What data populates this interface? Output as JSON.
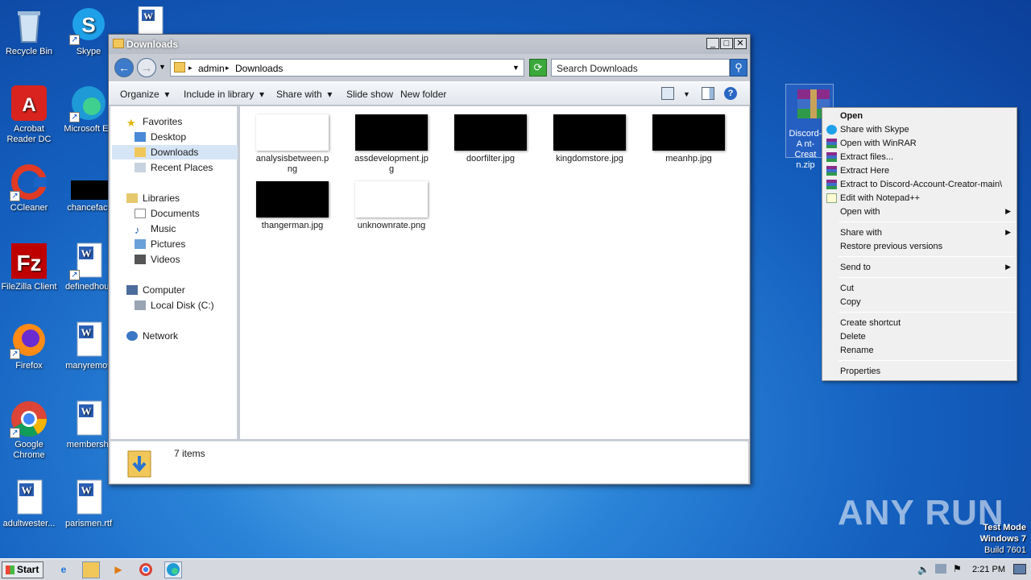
{
  "desktop": {
    "icons": [
      {
        "label": "Recycle Bin",
        "icon": "recycle-bin-icon"
      },
      {
        "label": "Skype",
        "icon": "skype-icon"
      },
      {
        "label": "",
        "icon": "word-doc-icon"
      },
      {
        "label": "Acrobat Reader DC",
        "icon": "acrobat-icon"
      },
      {
        "label": "Microsoft Ed",
        "icon": "edge-icon"
      },
      {
        "label": "CCleaner",
        "icon": "ccleaner-icon"
      },
      {
        "label": "chancefact",
        "icon": "black-file-icon"
      },
      {
        "label": "FileZilla Client",
        "icon": "filezilla-icon"
      },
      {
        "label": "definedhour",
        "icon": "word-doc-icon"
      },
      {
        "label": "Firefox",
        "icon": "firefox-icon"
      },
      {
        "label": "manyremov",
        "icon": "word-doc-icon"
      },
      {
        "label": "Google Chrome",
        "icon": "chrome-icon"
      },
      {
        "label": "membershi",
        "icon": "word-doc-icon"
      },
      {
        "label": "adultwester...",
        "icon": "word-doc-icon"
      },
      {
        "label": "parismen.rtf",
        "icon": "word-doc-icon"
      }
    ],
    "zip_label": "Discord-A nt-Creat n.zip",
    "watermark": "ANY RUN",
    "testmode": [
      "Test Mode",
      "Windows 7",
      "Build 7601"
    ]
  },
  "window": {
    "title": "Downloads",
    "address": {
      "segments": [
        "admin",
        "Downloads"
      ]
    },
    "search_placeholder": "Search Downloads",
    "toolbar": [
      "Organize",
      "Include in library",
      "Share with",
      "Slide show",
      "New folder"
    ],
    "nav": {
      "favorites": "Favorites",
      "favorites_items": [
        "Desktop",
        "Downloads",
        "Recent Places"
      ],
      "libraries": "Libraries",
      "libraries_items": [
        "Documents",
        "Music",
        "Pictures",
        "Videos"
      ],
      "computer": "Computer",
      "computer_items": [
        "Local Disk (C:)"
      ],
      "network": "Network"
    },
    "files": [
      {
        "name": "analysisbetween.png",
        "thumb": "#ffffff"
      },
      {
        "name": "assdevelopment.jpg",
        "thumb": "#000000"
      },
      {
        "name": "doorfilter.jpg",
        "thumb": "#000000"
      },
      {
        "name": "kingdomstore.jpg",
        "thumb": "#000000"
      },
      {
        "name": "meanhp.jpg",
        "thumb": "#000000"
      },
      {
        "name": "thangerman.jpg",
        "thumb": "#000000"
      },
      {
        "name": "unknownrate.png",
        "thumb": "#ffffff"
      }
    ],
    "status": "7 items"
  },
  "context_menu": {
    "items": [
      {
        "label": "Open",
        "bold": true
      },
      {
        "label": "Share with Skype",
        "icon": "skype-icon"
      },
      {
        "label": "Open with WinRAR",
        "icon": "winrar-icon"
      },
      {
        "label": "Extract files...",
        "icon": "winrar-icon"
      },
      {
        "label": "Extract Here",
        "icon": "winrar-icon"
      },
      {
        "label": "Extract to Discord-Account-Creator-main\\",
        "icon": "winrar-icon"
      },
      {
        "label": "Edit with Notepad++",
        "icon": "notepad-icon"
      },
      {
        "label": "Open with",
        "submenu": true
      },
      {
        "label": "Share with",
        "submenu": true
      },
      {
        "label": "Restore previous versions"
      },
      {
        "label": "Send to",
        "submenu": true
      },
      {
        "label": "Cut"
      },
      {
        "label": "Copy"
      },
      {
        "label": "Create shortcut"
      },
      {
        "label": "Delete"
      },
      {
        "label": "Rename"
      },
      {
        "label": "Properties"
      }
    ]
  },
  "taskbar": {
    "start": "Start",
    "clock": "2:21 PM",
    "pinned": [
      "ie-icon",
      "explorer-icon",
      "media-player-icon",
      "chrome-icon",
      "edge-icon"
    ]
  },
  "colors": {
    "accent": "#2b84d8",
    "window_bg": "#c7ccd4",
    "selection": "#d6e5f5"
  }
}
